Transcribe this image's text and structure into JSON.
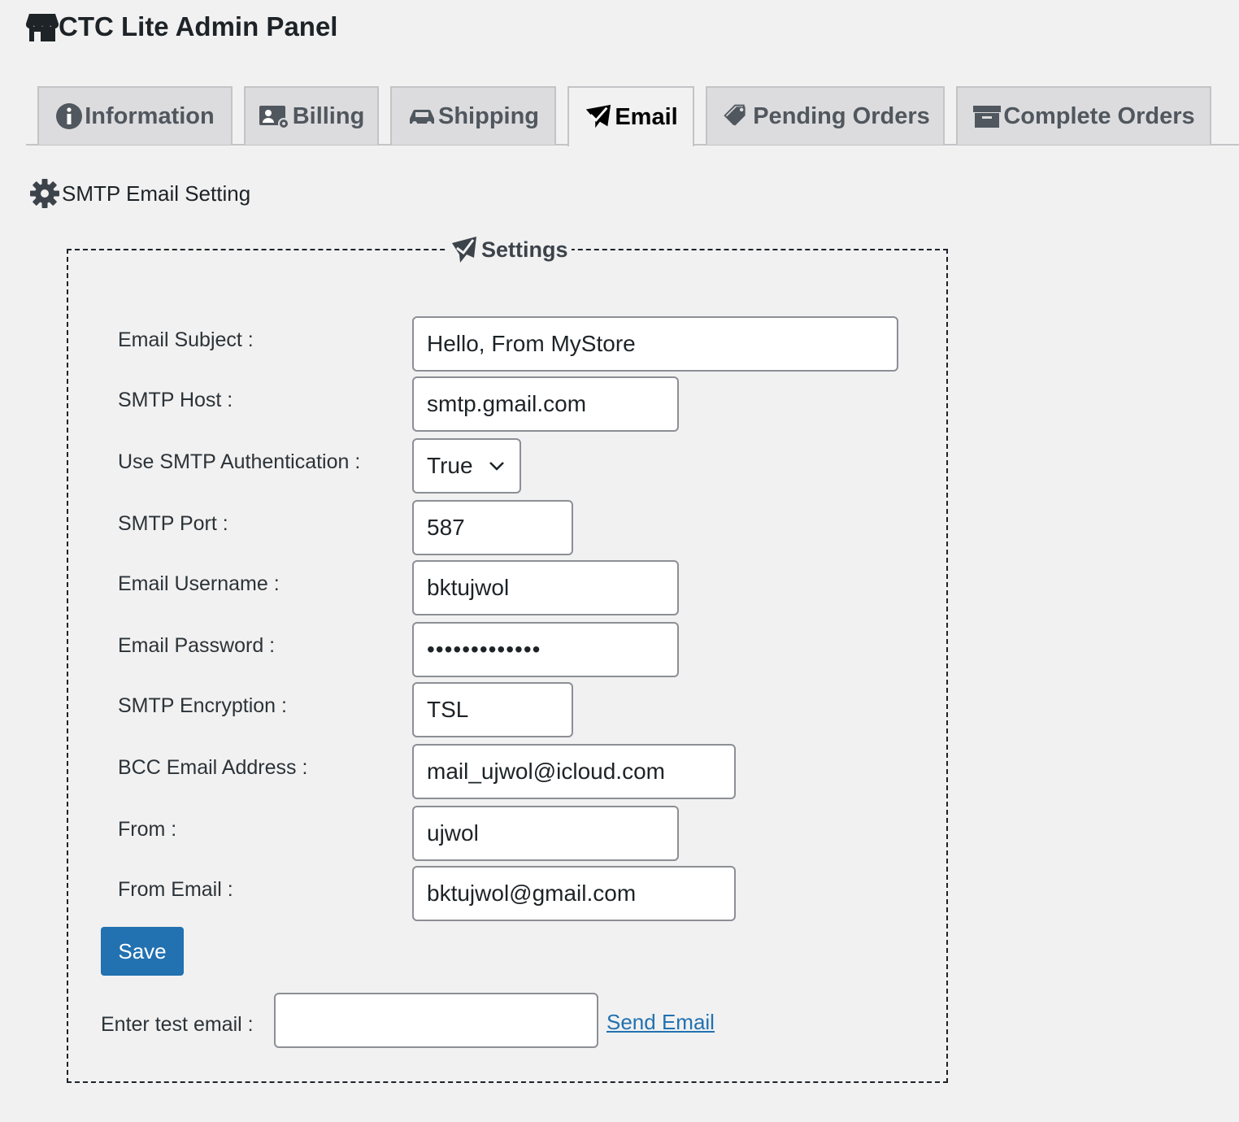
{
  "app": {
    "title": "CTC Lite Admin Panel",
    "icon": "store-icon"
  },
  "tabs": [
    {
      "label": "Information",
      "icon": "info-circle-icon",
      "active": false
    },
    {
      "label": "Billing",
      "icon": "billing-card-icon",
      "active": false
    },
    {
      "label": "Shipping",
      "icon": "car-icon",
      "active": false
    },
    {
      "label": "Email",
      "icon": "paper-plane-icon",
      "active": true
    },
    {
      "label": "Pending Orders",
      "icon": "tags-icon",
      "active": false
    },
    {
      "label": "Complete Orders",
      "icon": "archive-box-icon",
      "active": false
    }
  ],
  "section": {
    "title": "SMTP Email Setting",
    "icon": "gear-icon"
  },
  "settings": {
    "legend": "Settings",
    "legend_icon": "paper-plane-icon",
    "fields": [
      {
        "label": "Email Subject :",
        "value": "Hello, From MyStore"
      },
      {
        "label": "SMTP Host :",
        "value": "smtp.gmail.com"
      },
      {
        "label": "Use SMTP Authentication :",
        "value": "True"
      },
      {
        "label": "SMTP Port :",
        "value": "587"
      },
      {
        "label": "Email Username :",
        "value": "bktujwol"
      },
      {
        "label": "Email Password :",
        "value": "•••••••••••••"
      },
      {
        "label": "SMTP Encryption :",
        "value": "TSL"
      },
      {
        "label": "BCC Email Address :",
        "value": "mail_ujwol@icloud.com"
      },
      {
        "label": "From :",
        "value": "ujwol"
      },
      {
        "label": "From Email :",
        "value": "bktujwol@gmail.com"
      }
    ],
    "save_label": "Save",
    "test_email_label": "Enter test email :",
    "test_email_value": "",
    "send_email_label": "Send Email"
  },
  "colors": {
    "accent": "#2271b1",
    "background": "#f1f1f1",
    "tab_inactive": "#dcdcde"
  }
}
